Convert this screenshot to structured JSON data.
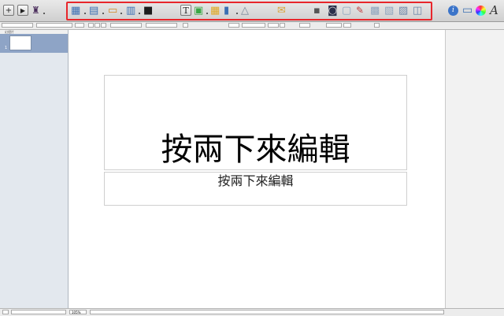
{
  "toolbar": {
    "left_buttons": [
      {
        "name": "add-slide-button",
        "glyph": "+"
      },
      {
        "name": "play-button",
        "glyph": "▶"
      },
      {
        "name": "theme-button",
        "glyph": "♜"
      }
    ],
    "insert_group": [
      {
        "name": "view-icon",
        "glyph": "▦"
      },
      {
        "name": "masters-icon",
        "glyph": "▤"
      },
      {
        "name": "themes-icon",
        "glyph": "▭"
      },
      {
        "name": "table-layout-icon",
        "glyph": "▥"
      },
      {
        "name": "media-icon",
        "glyph": "■"
      },
      {
        "name": "text-box-icon",
        "glyph": "T"
      },
      {
        "name": "shapes-icon",
        "glyph": "▣"
      },
      {
        "name": "table-icon",
        "glyph": "▦"
      },
      {
        "name": "chart-icon",
        "glyph": "▮"
      },
      {
        "name": "drawing-icon",
        "glyph": "△"
      },
      {
        "name": "comment-icon",
        "glyph": "✉"
      },
      {
        "name": "mask-icon",
        "glyph": "▪"
      },
      {
        "name": "alpha-icon",
        "glyph": "◙"
      },
      {
        "name": "group-icon",
        "glyph": "▢"
      },
      {
        "name": "adjust-icon",
        "glyph": "✎"
      },
      {
        "name": "front-icon",
        "glyph": "▩"
      },
      {
        "name": "back-icon",
        "glyph": "▧"
      },
      {
        "name": "arrange-icon",
        "glyph": "▨"
      },
      {
        "name": "ungroup-icon",
        "glyph": "◫"
      }
    ],
    "right_buttons": [
      {
        "name": "inspector-icon",
        "glyph": "i"
      },
      {
        "name": "media-browser-icon",
        "glyph": "▭"
      },
      {
        "name": "colors-icon",
        "glyph": "●"
      },
      {
        "name": "fonts-icon",
        "glyph": "A"
      }
    ]
  },
  "sidebar": {
    "header": "幻燈片",
    "slides": [
      {
        "number": "1"
      }
    ]
  },
  "slide": {
    "title": "按兩下來編輯",
    "subtitle": "按兩下來編輯"
  },
  "statusbar": {
    "zoom": "105%"
  },
  "colors": {
    "highlight": "#e8262b",
    "selected_slide": "#8ea4c6"
  }
}
